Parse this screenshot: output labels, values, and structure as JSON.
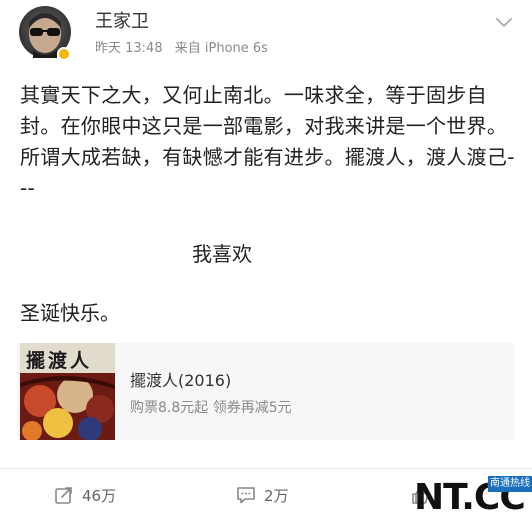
{
  "author": {
    "name": "王家卫",
    "time": "昨天 13:48",
    "source": "来自 iPhone 6s",
    "avatar_icon": "sunglasses-avatar",
    "verified_icon": "verified-badge-icon",
    "verified_color": "#f5b800"
  },
  "post": {
    "paragraph": "其實天下之大，又何止南北。一味求全，等于固步自封。在你眼中这只是一部電影，对我来讲是一个世界。所谓大成若缺，有缺憾才能有进步。擺渡人，渡人渡己---",
    "center_line": "我喜欢",
    "closing": "圣诞快乐。"
  },
  "movie": {
    "title": "擺渡人(2016)",
    "subtitle": "购票8.8元起 领券再减5元",
    "poster_text": "擺渡人"
  },
  "actions": {
    "repost_icon": "repost-icon",
    "repost_count": "46万",
    "comment_icon": "comment-icon",
    "comment_count": "2万",
    "like_icon": "like-icon"
  },
  "watermark": {
    "brand": "NT.CC",
    "tag": "南通热线",
    "tag_color": "#1a6fbf"
  }
}
